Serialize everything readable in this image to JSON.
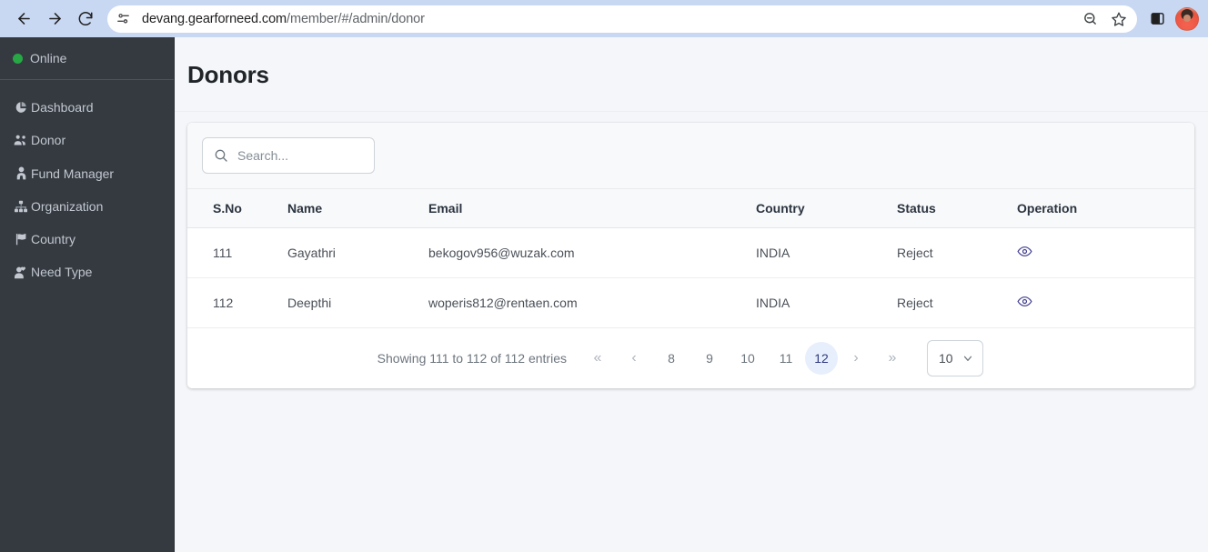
{
  "browser": {
    "back_label": "Back",
    "forward_label": "Forward",
    "reload_label": "Reload",
    "site_info_label": "View site information",
    "url_host": "devang.gearforneed.com",
    "url_path": "/member/#/admin/donor",
    "zoom_icon_label": "Zoom",
    "bookmark_label": "Bookmark this tab",
    "side_panel_label": "Side panel",
    "profile_label": "Profile"
  },
  "sidebar": {
    "status_label": "Online",
    "status_color": "#28a745",
    "background": "#343a40",
    "items": [
      {
        "label": "Dashboard",
        "icon": "pie-chart-icon"
      },
      {
        "label": "Donor",
        "icon": "users-icon"
      },
      {
        "label": "Fund Manager",
        "icon": "user-tie-icon"
      },
      {
        "label": "Organization",
        "icon": "sitemap-icon"
      },
      {
        "label": "Country",
        "icon": "flag-icon"
      },
      {
        "label": "Need Type",
        "icon": "user-heart-icon"
      }
    ]
  },
  "header": {
    "title": "Donors"
  },
  "search": {
    "value": "",
    "placeholder": "Search..."
  },
  "table": {
    "columns": [
      "S.No",
      "Name",
      "Email",
      "Country",
      "Status",
      "Operation"
    ],
    "rows": [
      {
        "sno": "111",
        "name": "Gayathri",
        "email": "bekogov956@wuzak.com",
        "country": "INDIA",
        "status": "Reject",
        "operation": "view-icon"
      },
      {
        "sno": "112",
        "name": "Deepthi",
        "email": "woperis812@rentaen.com",
        "country": "INDIA",
        "status": "Reject",
        "operation": "view-icon"
      }
    ]
  },
  "pagination": {
    "showing_text": "Showing 111 to 112 of 112 entries",
    "first_label": "«",
    "prev_label": "‹",
    "next_label": "›",
    "last_label": "»",
    "pages": [
      "8",
      "9",
      "10",
      "11",
      "12"
    ],
    "active_page": "12",
    "active_color": "#e7effc",
    "per_page_value": "10"
  }
}
